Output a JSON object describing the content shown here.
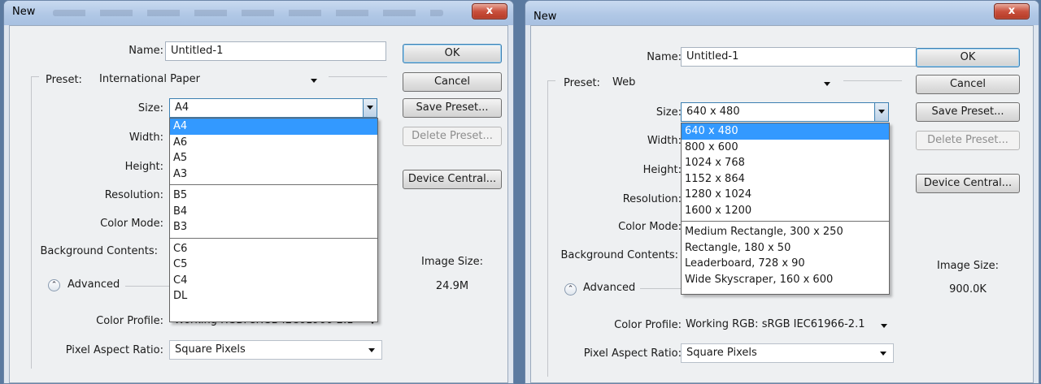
{
  "left_dialog": {
    "title": "New",
    "close_label": "x",
    "labels": {
      "name": "Name:",
      "preset": "Preset:",
      "size": "Size:",
      "width": "Width:",
      "height": "Height:",
      "resolution": "Resolution:",
      "color_mode": "Color Mode:",
      "background_contents": "Background Contents:",
      "advanced": "Advanced",
      "color_profile": "Color Profile:",
      "pixel_aspect_ratio": "Pixel Aspect Ratio:"
    },
    "name_value": "Untitled-1",
    "preset_value": "International Paper",
    "size_value": "A4",
    "color_profile_value": "Working RGB:  sRGB IEC61966-2.1",
    "pixel_aspect_value": "Square Pixels",
    "buttons": {
      "ok": "OK",
      "cancel": "Cancel",
      "save_preset": "Save Preset...",
      "delete_preset": "Delete Preset...",
      "device_central": "Device Central..."
    },
    "image_size_label": "Image Size:",
    "image_size_value": "24.9M",
    "size_options": {
      "group1": [
        "A4",
        "A6",
        "A5",
        "A3"
      ],
      "group2": [
        "B5",
        "B4",
        "B3"
      ],
      "group3": [
        "C6",
        "C5",
        "C4",
        "DL"
      ]
    },
    "selected_option": "A4"
  },
  "right_dialog": {
    "title": "New",
    "close_label": "x",
    "labels": {
      "name": "Name:",
      "preset": "Preset:",
      "size": "Size:",
      "width": "Width:",
      "height": "Height:",
      "resolution": "Resolution:",
      "color_mode": "Color Mode:",
      "background_contents": "Background Contents:",
      "advanced": "Advanced",
      "color_profile": "Color Profile:",
      "pixel_aspect_ratio": "Pixel Aspect Ratio:"
    },
    "name_value": "Untitled-1",
    "preset_value": "Web",
    "size_value": "640 x 480",
    "color_profile_value": "Working RGB:  sRGB IEC61966-2.1",
    "pixel_aspect_value": "Square Pixels",
    "buttons": {
      "ok": "OK",
      "cancel": "Cancel",
      "save_preset": "Save Preset...",
      "delete_preset": "Delete Preset...",
      "device_central": "Device Central..."
    },
    "image_size_label": "Image Size:",
    "image_size_value": "900.0K",
    "size_options": {
      "group1": [
        "640 x 480",
        "800 x 600",
        "1024 x 768",
        "1152 x 864",
        "1280 x 1024",
        "1600 x 1200"
      ],
      "group2": [
        "Medium Rectangle, 300 x 250",
        "Rectangle, 180 x 50",
        "Leaderboard, 728 x 90",
        "Wide Skyscraper, 160 x 600"
      ]
    },
    "selected_option": "640 x 480"
  },
  "colors": {
    "highlight": "#3399ff",
    "close_button": "#c9503d",
    "titlebar": "#b1c8e6"
  }
}
